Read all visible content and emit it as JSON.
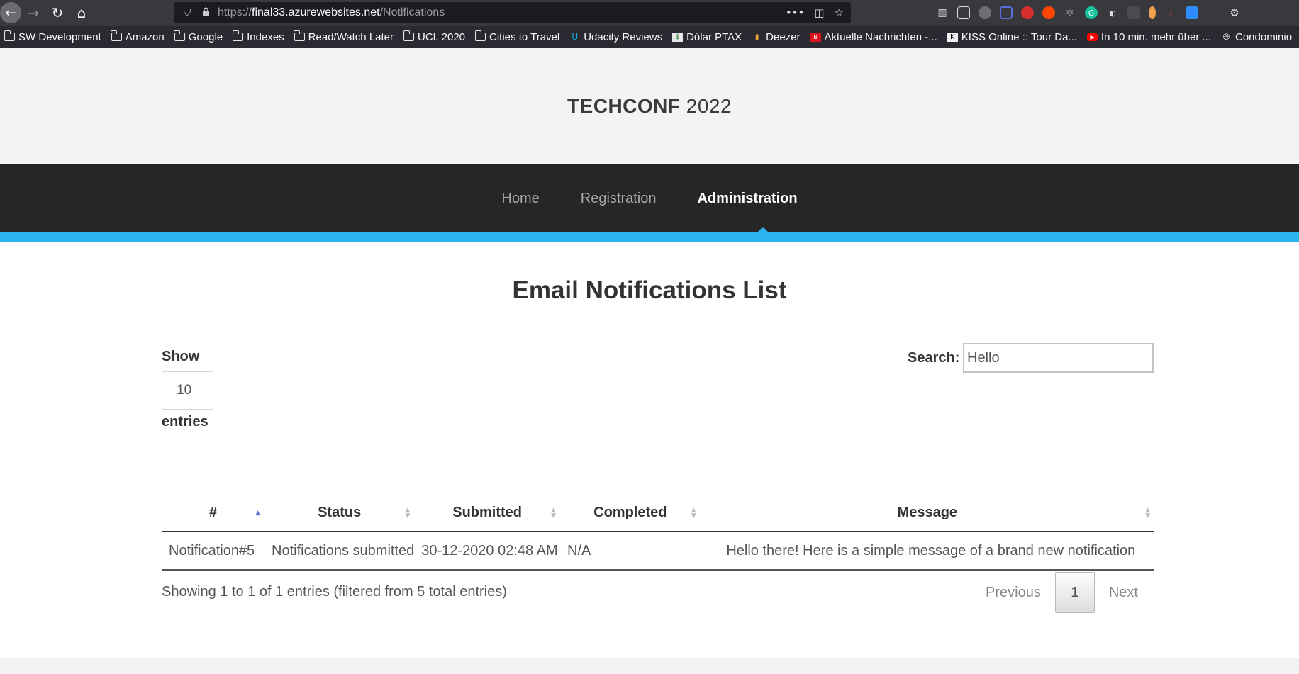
{
  "browser": {
    "back_icon": "←",
    "forward_icon": "→",
    "reload_icon": "↻",
    "home_icon": "⌂",
    "shield_icon": "⛉",
    "lock_icon": "🔒",
    "url_prefix": "https://",
    "url_host": "final33.azurewebsites.net",
    "url_path": "/Notifications",
    "menu_icon": "•••",
    "pocket_icon": "◫",
    "star_icon": "☆"
  },
  "bookmarks": [
    {
      "label": "SW Development",
      "icon": "folder"
    },
    {
      "label": "Amazon",
      "icon": "folder"
    },
    {
      "label": "Google",
      "icon": "folder"
    },
    {
      "label": "Indexes",
      "icon": "folder"
    },
    {
      "label": "Read/Watch Later",
      "icon": "folder"
    },
    {
      "label": "UCL 2020",
      "icon": "folder"
    },
    {
      "label": "Cities to Travel",
      "icon": "folder"
    },
    {
      "label": "Udacity Reviews",
      "icon": "udacity"
    },
    {
      "label": "Dólar PTAX",
      "icon": "ptax"
    },
    {
      "label": "Deezer",
      "icon": "deezer"
    },
    {
      "label": "Aktuelle Nachrichten -...",
      "icon": "bild"
    },
    {
      "label": "KISS Online :: Tour Da...",
      "icon": "kiss"
    },
    {
      "label": "In 10 min. mehr über ...",
      "icon": "youtube"
    },
    {
      "label": "Condominio",
      "icon": "globe"
    }
  ],
  "site": {
    "brand_bold": "TECHCONF",
    "brand_year": "2022"
  },
  "nav": {
    "home": "Home",
    "registration": "Registration",
    "administration": "Administration",
    "active": "administration"
  },
  "page": {
    "title": "Email Notifications List",
    "show_label": "Show",
    "page_length": "10",
    "entries_label": "entries",
    "search_label": "Search:",
    "search_value": "Hello"
  },
  "table": {
    "columns": [
      "#",
      "Status",
      "Submitted",
      "Completed",
      "Message"
    ],
    "sorted_column": "#",
    "rows": [
      [
        "Notification#5",
        "Notifications submitted",
        "30-12-2020 02:48 AM",
        "N/A",
        "Hello there! Here is a simple message of a brand new notification"
      ]
    ]
  },
  "footer_info": {
    "summary": "Showing 1 to 1 of 1 entries (filtered from 5 total entries)",
    "previous": "Previous",
    "current_page": "1",
    "next": "Next"
  },
  "colors": {
    "accent": "#2ab4ef",
    "nav_bg": "#262626",
    "header_bg": "#f3f3f3"
  }
}
